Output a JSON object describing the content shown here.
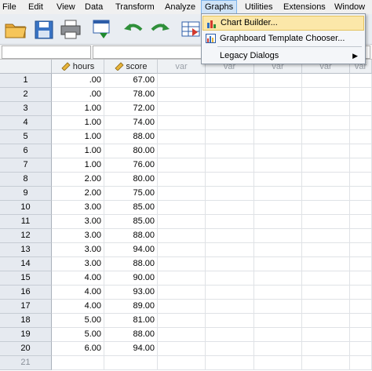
{
  "menu": {
    "file": "File",
    "edit": "Edit",
    "view": "View",
    "data": "Data",
    "transform": "Transform",
    "analyze": "Analyze",
    "graphs": "Graphs",
    "utilities": "Utilities",
    "extensions": "Extensions",
    "window": "Window"
  },
  "graphs_menu": {
    "chart_builder": "Chart Builder...",
    "graphboard": "Graphboard Template Chooser...",
    "legacy": "Legacy Dialogs",
    "legacy_arrow": "▶"
  },
  "columns": {
    "c1": "hours",
    "c2": "score",
    "var": [
      "var",
      "var",
      "var",
      "var",
      "var"
    ]
  },
  "rows": [
    {
      "n": "1",
      "hours": ".00",
      "score": "67.00"
    },
    {
      "n": "2",
      "hours": ".00",
      "score": "78.00"
    },
    {
      "n": "3",
      "hours": "1.00",
      "score": "72.00"
    },
    {
      "n": "4",
      "hours": "1.00",
      "score": "74.00"
    },
    {
      "n": "5",
      "hours": "1.00",
      "score": "88.00"
    },
    {
      "n": "6",
      "hours": "1.00",
      "score": "80.00"
    },
    {
      "n": "7",
      "hours": "1.00",
      "score": "76.00"
    },
    {
      "n": "8",
      "hours": "2.00",
      "score": "80.00"
    },
    {
      "n": "9",
      "hours": "2.00",
      "score": "75.00"
    },
    {
      "n": "10",
      "hours": "3.00",
      "score": "85.00"
    },
    {
      "n": "11",
      "hours": "3.00",
      "score": "85.00"
    },
    {
      "n": "12",
      "hours": "3.00",
      "score": "88.00"
    },
    {
      "n": "13",
      "hours": "3.00",
      "score": "94.00"
    },
    {
      "n": "14",
      "hours": "3.00",
      "score": "88.00"
    },
    {
      "n": "15",
      "hours": "4.00",
      "score": "90.00"
    },
    {
      "n": "16",
      "hours": "4.00",
      "score": "93.00"
    },
    {
      "n": "17",
      "hours": "4.00",
      "score": "89.00"
    },
    {
      "n": "18",
      "hours": "5.00",
      "score": "81.00"
    },
    {
      "n": "19",
      "hours": "5.00",
      "score": "88.00"
    },
    {
      "n": "20",
      "hours": "6.00",
      "score": "94.00"
    },
    {
      "n": "21",
      "hours": "",
      "score": ""
    }
  ],
  "colors": {
    "accent": "#fbe7a9",
    "menu_active": "#cfe3f7",
    "header_bg": "#eef1f4",
    "row_header_bg": "#e6eaf0"
  }
}
